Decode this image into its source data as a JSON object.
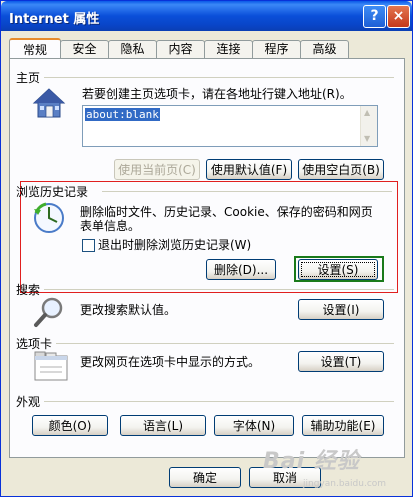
{
  "window": {
    "title": "Internet 属性"
  },
  "titlebar": {
    "help_glyph": "?",
    "close_glyph": "×"
  },
  "tabs": [
    {
      "label": "常规",
      "active": true
    },
    {
      "label": "安全"
    },
    {
      "label": "隐私"
    },
    {
      "label": "内容"
    },
    {
      "label": "连接"
    },
    {
      "label": "程序"
    },
    {
      "label": "高级"
    }
  ],
  "homepage": {
    "section": "主页",
    "description": "若要创建主页选项卡，请在各地址行键入地址(R)。",
    "value": "about:blank",
    "buttons": {
      "use_current": "使用当前页(C)",
      "use_default": "使用默认值(F)",
      "use_blank": "使用空白页(B)"
    }
  },
  "history": {
    "section": "浏览历史记录",
    "description_line1": "删除临时文件、历史记录、Cookie、保存的密码和网页",
    "description_line2": "表单信息。",
    "checkbox_label": "退出时删除浏览历史记录(W)",
    "delete_button": "删除(D)...",
    "settings_button": "设置(S)"
  },
  "search": {
    "section": "搜索",
    "description": "更改搜索默认值。",
    "settings_button": "设置(I)"
  },
  "tabs_section": {
    "section": "选项卡",
    "description": "更改网页在选项卡中显示的方式。",
    "settings_button": "设置(T)"
  },
  "appearance": {
    "section": "外观",
    "buttons": {
      "colors": "颜色(O)",
      "languages": "语言(L)",
      "fonts": "字体(N)",
      "accessibility": "辅助功能(E)"
    }
  },
  "footer": {
    "ok": "确定",
    "cancel": "取消"
  },
  "watermark": {
    "text": "Bai 经验",
    "sub": "jingyan.baidu.com"
  },
  "colors": {
    "title_blue": "#0a4fd9",
    "highlight_red": "#e01f1f",
    "highlight_green": "#1a7a1a",
    "selection": "#316ac5"
  }
}
